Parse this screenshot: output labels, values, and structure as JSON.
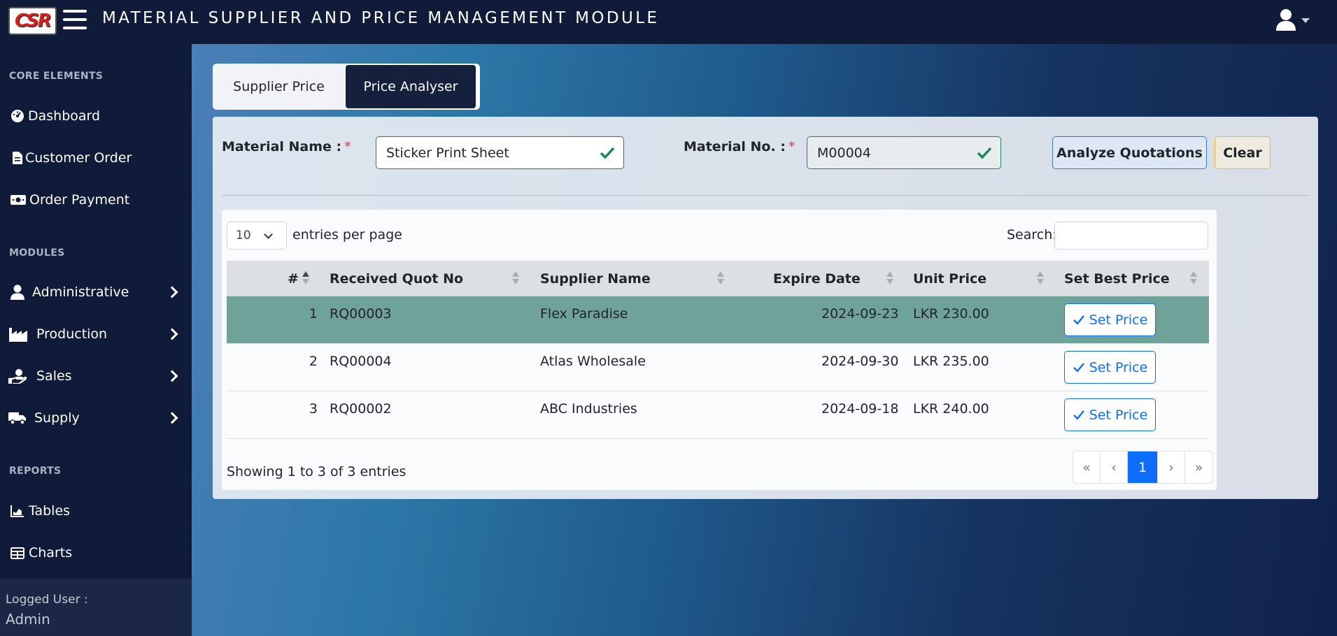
{
  "brand": {
    "logo_text": "CSR"
  },
  "header": {
    "title": "MATERIAL SUPPLIER AND PRICE MANAGEMENT MODULE"
  },
  "sidebar": {
    "sections": {
      "core": "CORE ELEMENTS",
      "modules": "MODULES",
      "reports": "REPORTS"
    },
    "items": {
      "dashboard": "Dashboard",
      "customer_order": "Customer Order",
      "order_payment": "Order Payment",
      "administrative": "Administrative",
      "production": "Production",
      "sales": "Sales",
      "supply": "Supply",
      "tables": "Tables",
      "charts": "Charts"
    },
    "footer": {
      "label": "Logged User :",
      "user": "Admin"
    }
  },
  "tabs": {
    "supplier_price": "Supplier Price",
    "price_analyser": "Price Analyser",
    "active": "Price Analyser"
  },
  "form": {
    "material_name_label": "Material Name :",
    "material_name_value": "Sticker Print Sheet",
    "material_no_label": "Material No. :",
    "material_no_value": "M00004",
    "required_mark": "*",
    "analyze_button": "Analyze Quotations",
    "clear_button": "Clear"
  },
  "table": {
    "length_value": "10",
    "length_label": "entries per page",
    "search_label": "Search:",
    "columns": [
      "#",
      "Received Quot No",
      "Supplier Name",
      "Expire Date",
      "Unit Price",
      "Set Best Price"
    ],
    "rows": [
      {
        "index": "1",
        "quot_no": "RQ00003",
        "supplier": "Flex Paradise",
        "expire": "2024-09-23",
        "price": "LKR 230.00",
        "action": "Set Price"
      },
      {
        "index": "2",
        "quot_no": "RQ00004",
        "supplier": "Atlas Wholesale",
        "expire": "2024-09-30",
        "price": "LKR 235.00",
        "action": "Set Price"
      },
      {
        "index": "3",
        "quot_no": "RQ00002",
        "supplier": "ABC Industries",
        "expire": "2024-09-18",
        "price": "LKR 240.00",
        "action": "Set Price"
      }
    ],
    "info": "Showing 1 to 3 of 3 entries",
    "pager": {
      "first": "«",
      "prev": "‹",
      "current": "1",
      "next": "›",
      "last": "»"
    }
  },
  "colors": {
    "nav_bg": "#0f1b38",
    "best_row": "#6fa299",
    "primary": "#0d6efd",
    "valid": "#198754",
    "warning": "#f3b530",
    "required": "#dc3545"
  },
  "icons": [
    "menu-icon",
    "user-icon",
    "dashboard-icon",
    "document-icon",
    "money-icon",
    "user-icon",
    "factory-icon",
    "hand-money-icon",
    "truck-icon",
    "chart-area-icon",
    "table-icon",
    "check-icon"
  ]
}
